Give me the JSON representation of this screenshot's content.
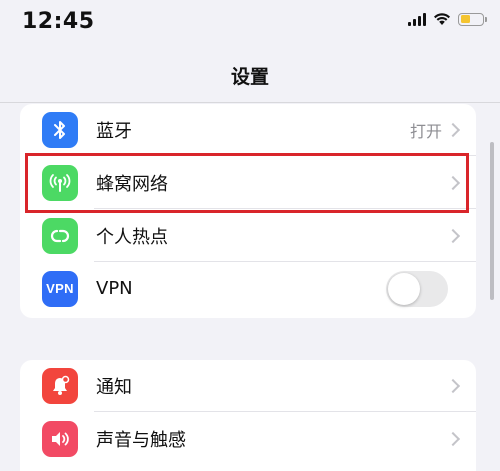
{
  "status_bar": {
    "time": "12:45",
    "battery_color": "#f4c430"
  },
  "nav": {
    "title": "设置"
  },
  "groups": [
    {
      "rows": [
        {
          "label": "蓝牙",
          "value": "打开",
          "icon": "bluetooth-icon",
          "icon_color": "#2f7cf6",
          "accessory": "chevron"
        },
        {
          "label": "蜂窝网络",
          "icon": "cellular-antenna-icon",
          "icon_color": "#4cd964",
          "accessory": "chevron",
          "highlighted": true
        },
        {
          "label": "个人热点",
          "icon": "personal-hotspot-icon",
          "icon_color": "#4cd964",
          "accessory": "chevron"
        },
        {
          "label": "VPN",
          "icon_text": "VPN",
          "icon": "vpn-icon",
          "icon_color": "#2f6df6",
          "accessory": "toggle",
          "toggle_on": false
        }
      ]
    },
    {
      "rows": [
        {
          "label": "通知",
          "icon": "notification-bell-icon",
          "icon_color": "#f2453d",
          "accessory": "chevron"
        },
        {
          "label": "声音与触感",
          "icon": "speaker-icon",
          "icon_color": "#f24a64",
          "accessory": "chevron"
        }
      ]
    }
  ],
  "highlight_color": "#d9252a"
}
